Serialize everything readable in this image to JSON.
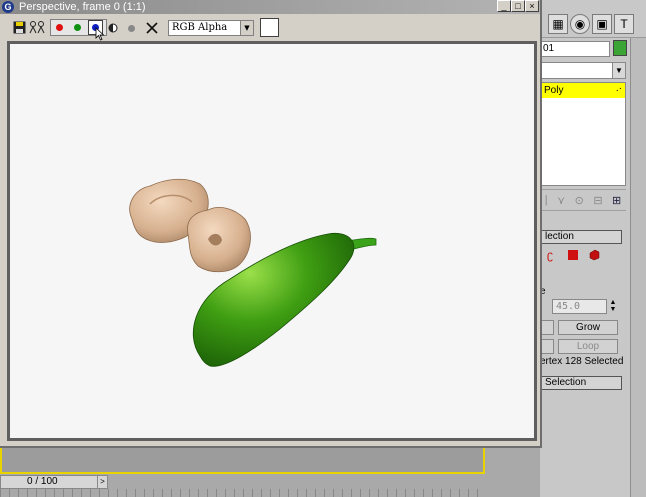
{
  "window": {
    "title": "Perspective, frame 0 (1:1)",
    "icon_glyph": "G",
    "buttons": {
      "minimize": "_",
      "maximize": "□",
      "close": "×"
    }
  },
  "toolbar": {
    "save_icon": "floppy-icon",
    "clone_icon": "clone-icon",
    "channels": [
      {
        "name": "red-channel",
        "color": "#e01010"
      },
      {
        "name": "green-channel",
        "color": "#109010"
      },
      {
        "name": "blue-channel",
        "color": "#1020c0"
      }
    ],
    "display_mode": "RGB Alpha"
  },
  "right_panel": {
    "object_name": "01",
    "object_color": "#3aa535",
    "stack_item": "Poly",
    "selection_header": "lection",
    "label_e": "e",
    "angle_value": "45.0",
    "grow_label": "Grow",
    "loop_label": "Loop",
    "selected_text": "ertex 128 Selected",
    "soft_selection_header": "Selection"
  },
  "timeline": {
    "frame_text": "0 / 100",
    "arrow": ">"
  },
  "scene": {
    "cucumber_color": "#3a9a12",
    "pepper_color": "#d9b89a"
  }
}
